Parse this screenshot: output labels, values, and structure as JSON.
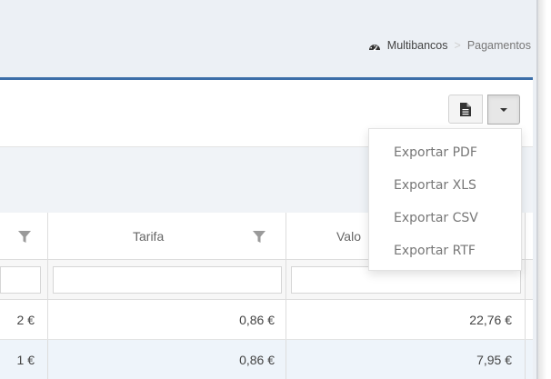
{
  "breadcrumb": {
    "root": "Multibancos",
    "separator": ">",
    "current": "Pagamentos"
  },
  "toolbar": {
    "export_icon": "file-icon",
    "caret_icon": "caret-down-icon"
  },
  "export_menu": {
    "items": [
      "Exportar PDF",
      "Exportar XLS",
      "Exportar CSV",
      "Exportar RTF"
    ]
  },
  "grid": {
    "columns": [
      "",
      "Tarifa",
      "Valo"
    ],
    "rows": [
      [
        "2 €",
        "0,86 €",
        "22,76 €"
      ],
      [
        "1 €",
        "0,86 €",
        "7,95 €"
      ]
    ]
  },
  "colors": {
    "panel_border": "#3c6ea8",
    "page_background": "#ecf0f5",
    "selected_row": "#eef4fa"
  }
}
